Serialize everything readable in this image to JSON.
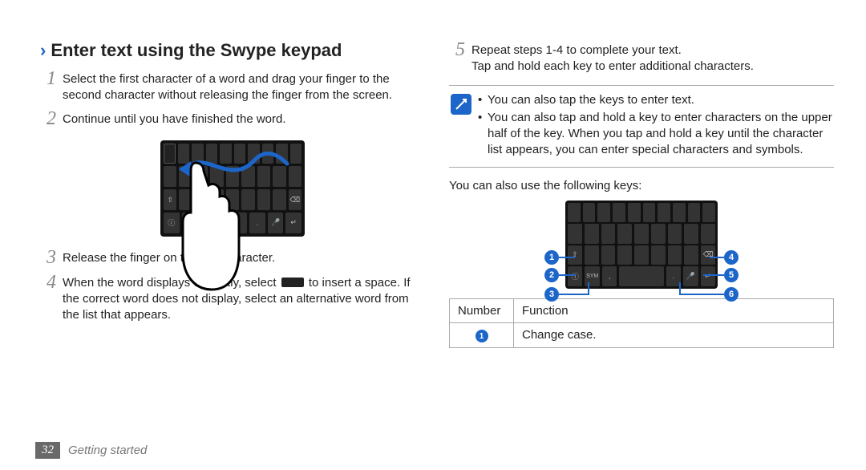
{
  "heading": "Enter text using the Swype keypad",
  "steps": {
    "s1": "Select the first character of a word and drag your finger to the second character without releasing the finger from the screen.",
    "s2": "Continue until you have finished the word.",
    "s3": "Release the finger on the last character.",
    "s4_a": "When the word displays correctly, select",
    "s4_b": "to insert a space. If the correct word does not display, select an alternative word from the list that appears.",
    "s5_a": "Repeat steps 1-4 to complete your text.",
    "s5_b": "Tap and hold each key to enter additional characters."
  },
  "notes": {
    "n1": "You can also tap the keys to enter text.",
    "n2": "You can also tap and hold a key to enter characters on the upper half of the key. When you tap and hold a key until the character list appears, you can enter special characters and symbols."
  },
  "subline": "You can also use the following keys:",
  "table": {
    "h1": "Number",
    "h2": "Function",
    "r1": "Change case."
  },
  "footer": {
    "page": "32",
    "section": "Getting started"
  },
  "callouts": [
    "1",
    "2",
    "3",
    "4",
    "5",
    "6"
  ],
  "sym_label": "SYM"
}
